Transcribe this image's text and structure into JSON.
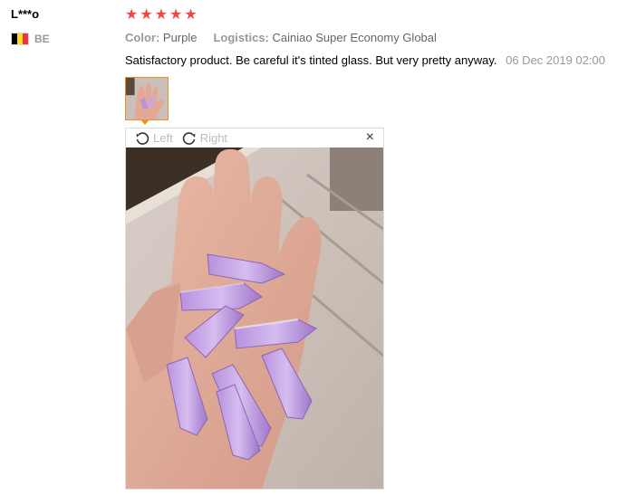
{
  "review": {
    "user": "L***o",
    "country_code": "BE",
    "rating": 5,
    "stars": [
      "★",
      "★",
      "★",
      "★",
      "★"
    ],
    "color_label": "Color:",
    "color_value": "Purple",
    "logistics_label": "Logistics:",
    "logistics_value": "Cainiao Super Economy Global",
    "text": "Satisfactory product. Be careful it's tinted glass. But very pretty anyway.",
    "date": "06 Dec 2019 02:00"
  },
  "viewer": {
    "rotate_left_label": "Left",
    "rotate_right_label": "Right",
    "close_glyph": "×"
  },
  "colors": {
    "star": "#f04848",
    "thumb_border": "#f08f22",
    "flag": [
      "#000000",
      "#fdda24",
      "#ef3340"
    ]
  }
}
